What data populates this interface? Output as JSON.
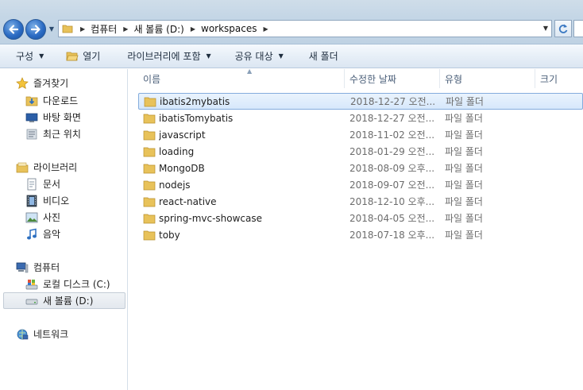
{
  "addressbar": {
    "breadcrumbs": [
      "컴퓨터",
      "새 볼륨 (D:)",
      "workspaces"
    ]
  },
  "toolbar": {
    "organize": "구성",
    "open": "열기",
    "include_library": "라이브러리에 포함",
    "share_with": "공유 대상",
    "new_folder": "새 폴더"
  },
  "navigation": {
    "favorites": {
      "label": "즐겨찾기",
      "items": [
        "다운로드",
        "바탕 화면",
        "최근 위치"
      ]
    },
    "libraries": {
      "label": "라이브러리",
      "items": [
        "문서",
        "비디오",
        "사진",
        "음악"
      ]
    },
    "computer": {
      "label": "컴퓨터",
      "items": [
        "로컬 디스크 (C:)",
        "새 볼륨 (D:)"
      ]
    },
    "network": {
      "label": "네트워크"
    }
  },
  "columns": {
    "name": "이름",
    "modified": "수정한 날짜",
    "type": "유형",
    "size": "크기"
  },
  "files": [
    {
      "name": "ibatis2mybatis",
      "modified": "2018-12-27 오전...",
      "type": "파일 폴더"
    },
    {
      "name": "ibatisTomybatis",
      "modified": "2018-12-27 오전...",
      "type": "파일 폴더"
    },
    {
      "name": "javascript",
      "modified": "2018-11-02 오전...",
      "type": "파일 폴더"
    },
    {
      "name": "loading",
      "modified": "2018-01-29 오전...",
      "type": "파일 폴더"
    },
    {
      "name": "MongoDB",
      "modified": "2018-08-09 오후...",
      "type": "파일 폴더"
    },
    {
      "name": "nodejs",
      "modified": "2018-09-07 오전...",
      "type": "파일 폴더"
    },
    {
      "name": "react-native",
      "modified": "2018-12-10 오후...",
      "type": "파일 폴더"
    },
    {
      "name": "spring-mvc-showcase",
      "modified": "2018-04-05 오전...",
      "type": "파일 폴더"
    },
    {
      "name": "toby",
      "modified": "2018-07-18 오후...",
      "type": "파일 폴더"
    }
  ],
  "colors": {
    "selection_border": "#84acdd",
    "folder_yellow": "#e8c25a",
    "chrome_blue": "#c4d6e6"
  }
}
